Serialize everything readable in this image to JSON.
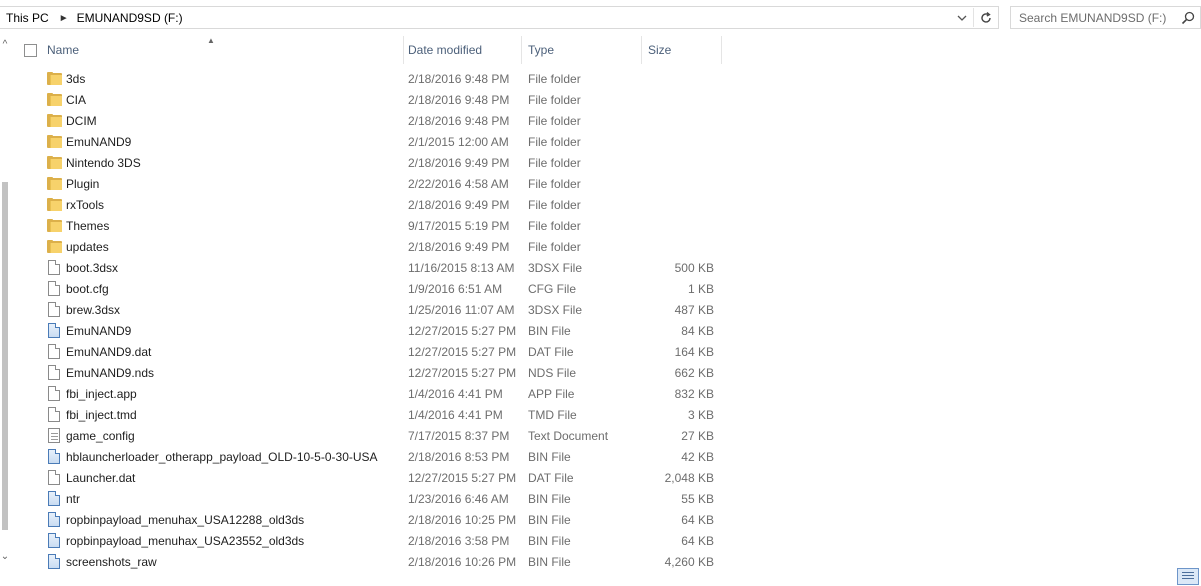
{
  "address": {
    "crumbs": [
      "This PC",
      "EMUNAND9SD (F:)"
    ]
  },
  "search": {
    "placeholder": "Search EMUNAND9SD (F:)"
  },
  "columns": {
    "name": "Name",
    "date": "Date modified",
    "type": "Type",
    "size": "Size"
  },
  "files": [
    {
      "icon": "folder-icon",
      "name": "3ds",
      "date": "2/18/2016 9:48 PM",
      "type": "File folder",
      "size": ""
    },
    {
      "icon": "folder-icon",
      "name": "CIA",
      "date": "2/18/2016 9:48 PM",
      "type": "File folder",
      "size": ""
    },
    {
      "icon": "folder-icon",
      "name": "DCIM",
      "date": "2/18/2016 9:48 PM",
      "type": "File folder",
      "size": ""
    },
    {
      "icon": "folder-icon",
      "name": "EmuNAND9",
      "date": "2/1/2015 12:00 AM",
      "type": "File folder",
      "size": ""
    },
    {
      "icon": "folder-icon",
      "name": "Nintendo 3DS",
      "date": "2/18/2016 9:49 PM",
      "type": "File folder",
      "size": ""
    },
    {
      "icon": "folder-icon",
      "name": "Plugin",
      "date": "2/22/2016 4:58 AM",
      "type": "File folder",
      "size": ""
    },
    {
      "icon": "folder-icon",
      "name": "rxTools",
      "date": "2/18/2016 9:49 PM",
      "type": "File folder",
      "size": ""
    },
    {
      "icon": "folder-icon",
      "name": "Themes",
      "date": "9/17/2015 5:19 PM",
      "type": "File folder",
      "size": ""
    },
    {
      "icon": "folder-icon",
      "name": "updates",
      "date": "2/18/2016 9:49 PM",
      "type": "File folder",
      "size": ""
    },
    {
      "icon": "document-icon",
      "name": "boot.3dsx",
      "date": "11/16/2015 8:13 AM",
      "type": "3DSX File",
      "size": "500 KB"
    },
    {
      "icon": "document-icon",
      "name": "boot.cfg",
      "date": "1/9/2016 6:51 AM",
      "type": "CFG File",
      "size": "1 KB"
    },
    {
      "icon": "document-icon",
      "name": "brew.3dsx",
      "date": "1/25/2016 11:07 AM",
      "type": "3DSX File",
      "size": "487 KB"
    },
    {
      "icon": "bin-file-icon",
      "name": "EmuNAND9",
      "date": "12/27/2015 5:27 PM",
      "type": "BIN File",
      "size": "84 KB"
    },
    {
      "icon": "document-icon",
      "name": "EmuNAND9.dat",
      "date": "12/27/2015 5:27 PM",
      "type": "DAT File",
      "size": "164 KB"
    },
    {
      "icon": "document-icon",
      "name": "EmuNAND9.nds",
      "date": "12/27/2015 5:27 PM",
      "type": "NDS File",
      "size": "662 KB"
    },
    {
      "icon": "document-icon",
      "name": "fbi_inject.app",
      "date": "1/4/2016 4:41 PM",
      "type": "APP File",
      "size": "832 KB"
    },
    {
      "icon": "document-icon",
      "name": "fbi_inject.tmd",
      "date": "1/4/2016 4:41 PM",
      "type": "TMD File",
      "size": "3 KB"
    },
    {
      "icon": "text-document-icon",
      "name": "game_config",
      "date": "7/17/2015 8:37 PM",
      "type": "Text Document",
      "size": "27 KB"
    },
    {
      "icon": "bin-file-icon",
      "name": "hblauncherloader_otherapp_payload_OLD-10-5-0-30-USA",
      "date": "2/18/2016 8:53 PM",
      "type": "BIN File",
      "size": "42 KB"
    },
    {
      "icon": "document-icon",
      "name": "Launcher.dat",
      "date": "12/27/2015 5:27 PM",
      "type": "DAT File",
      "size": "2,048 KB"
    },
    {
      "icon": "bin-file-icon",
      "name": "ntr",
      "date": "1/23/2016 6:46 AM",
      "type": "BIN File",
      "size": "55 KB"
    },
    {
      "icon": "bin-file-icon",
      "name": "ropbinpayload_menuhax_USA12288_old3ds",
      "date": "2/18/2016 10:25 PM",
      "type": "BIN File",
      "size": "64 KB"
    },
    {
      "icon": "bin-file-icon",
      "name": "ropbinpayload_menuhax_USA23552_old3ds",
      "date": "2/18/2016 3:58 PM",
      "type": "BIN File",
      "size": "64 KB"
    },
    {
      "icon": "bin-file-icon",
      "name": "screenshots_raw",
      "date": "2/18/2016 10:26 PM",
      "type": "BIN File",
      "size": "4,260 KB"
    }
  ]
}
